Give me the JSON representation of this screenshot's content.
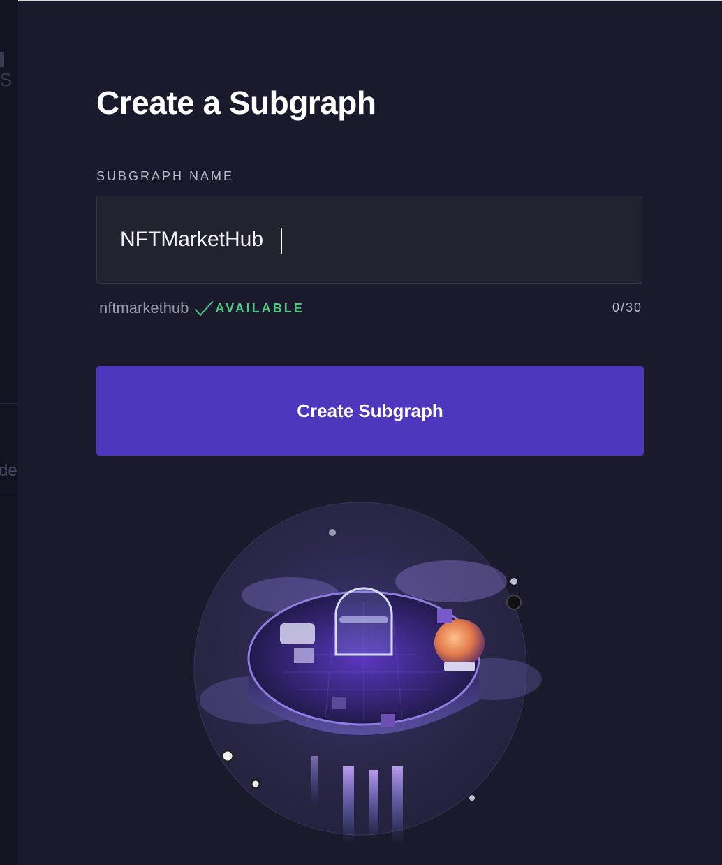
{
  "backdrop": {
    "fragment_top": "S",
    "fragment_mid": "de"
  },
  "modal": {
    "title": "Create a Subgraph",
    "field_label": "SUBGRAPH NAME",
    "input_value": "NFTMarketHub",
    "slug": "nftmarkethub",
    "availability": "AVAILABLE",
    "counter": "0/30",
    "create_label": "Create Subgraph"
  },
  "colors": {
    "background": "#1b1a2c",
    "input_bg": "#23222f",
    "accent": "#4d37bc",
    "available": "#4bca81"
  },
  "icons": {
    "availability": "check-icon"
  }
}
